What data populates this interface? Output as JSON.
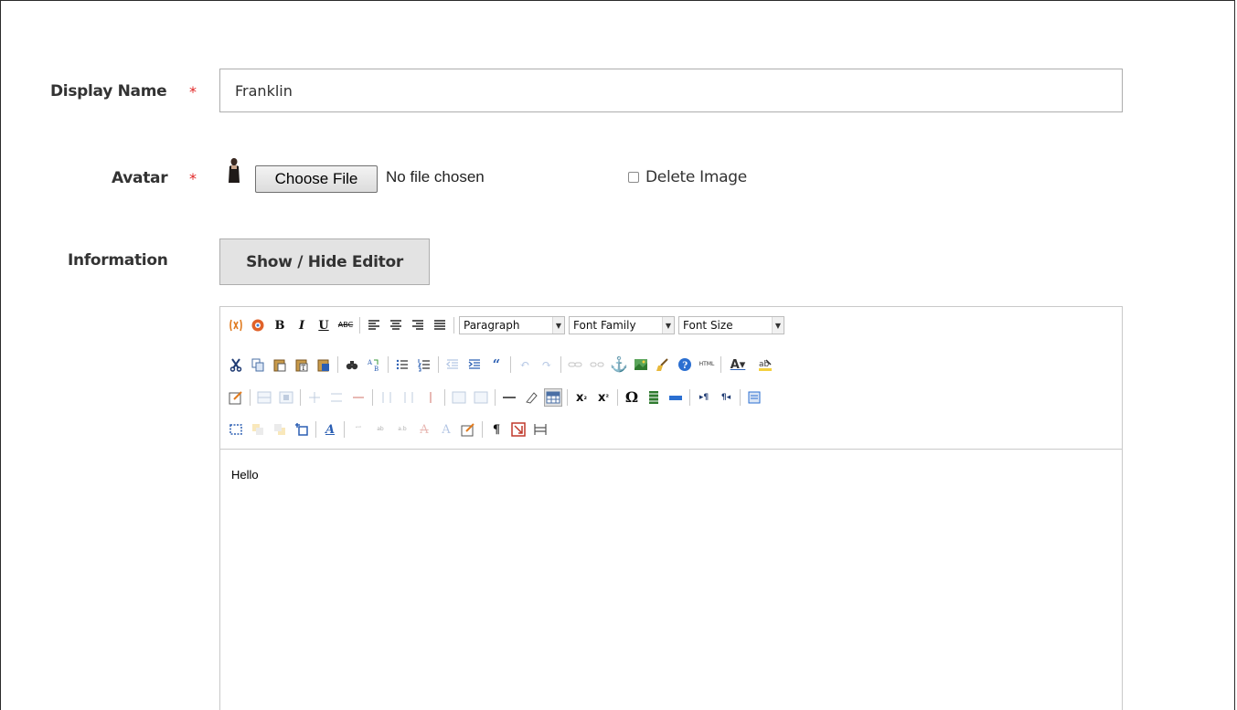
{
  "form": {
    "display_name_label": "Display Name",
    "display_name_value": "Franklin",
    "required_mark": "*",
    "avatar_label": "Avatar",
    "choose_file_label": "Choose File",
    "no_file_text": "No file chosen",
    "delete_image_label": "Delete Image",
    "information_label": "Information",
    "show_hide_editor_label": "Show / Hide Editor"
  },
  "editor": {
    "format_select": "Paragraph",
    "font_family_select": "Font Family",
    "font_size_select": "Font Size",
    "content": "Hello",
    "html_button_text": "HTML"
  },
  "colors": {
    "required": "#e22626",
    "border": "#adadad",
    "button_bg": "#e3e3e3"
  }
}
